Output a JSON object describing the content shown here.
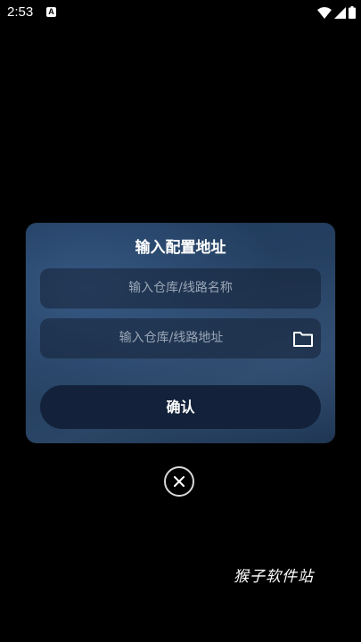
{
  "status_bar": {
    "time": "2:53",
    "notification_badge": "A",
    "icons": [
      "wifi-icon",
      "cellular-signal-icon",
      "battery-icon"
    ]
  },
  "dialog": {
    "title": "输入配置地址",
    "name_field": {
      "placeholder": "输入仓库/线路名称",
      "value": ""
    },
    "url_field": {
      "placeholder": "输入仓库/线路地址",
      "value": "",
      "icon": "folder-icon"
    },
    "confirm_label": "确认"
  },
  "close_icon": "close-icon",
  "watermark": "猴子软件站",
  "colors": {
    "background": "#000000",
    "dialog": "#243f60",
    "button": "#13223a",
    "placeholder": "#9aa6b6"
  }
}
